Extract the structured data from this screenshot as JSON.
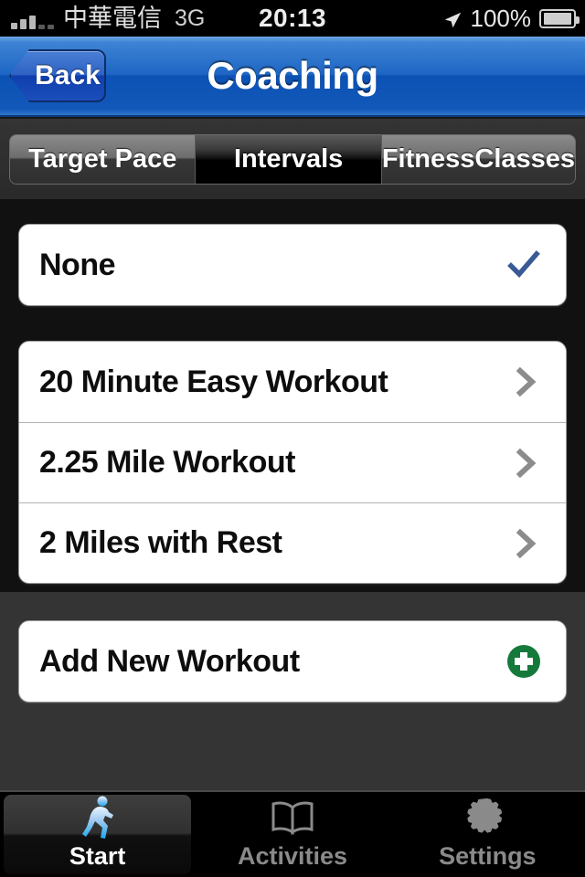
{
  "status_bar": {
    "signal_icon": "signal-bars-icon",
    "carrier": "中華電信",
    "network": "3G",
    "time": "20:13",
    "location_icon": "location-arrow-icon",
    "battery_percent": "100%",
    "battery_icon": "battery-full-icon"
  },
  "nav_bar": {
    "back_label": "Back",
    "title": "Coaching",
    "accent_color": "#1e66c4"
  },
  "segmented_control": {
    "segments": [
      {
        "label": "Target Pace",
        "selected": false
      },
      {
        "label": "Intervals",
        "selected": true
      },
      {
        "label": "FitnessClasses",
        "selected": false
      }
    ]
  },
  "main": {
    "none_row": {
      "label": "None",
      "accessory": "checkmark-icon",
      "checkmark_color": "#3a5a96"
    },
    "workouts": [
      {
        "label": "20 Minute Easy Workout",
        "accessory": "chevron-right-icon"
      },
      {
        "label": "2.25 Mile Workout",
        "accessory": "chevron-right-icon"
      },
      {
        "label": "2 Miles with Rest",
        "accessory": "chevron-right-icon"
      }
    ],
    "add_row": {
      "label": "Add New Workout",
      "accessory": "add-circle-icon",
      "accessory_color": "#15793c"
    }
  },
  "tab_bar": {
    "tabs": [
      {
        "label": "Start",
        "icon": "runner-icon",
        "selected": true
      },
      {
        "label": "Activities",
        "icon": "book-icon",
        "selected": false
      },
      {
        "label": "Settings",
        "icon": "gear-icon",
        "selected": false
      }
    ]
  }
}
